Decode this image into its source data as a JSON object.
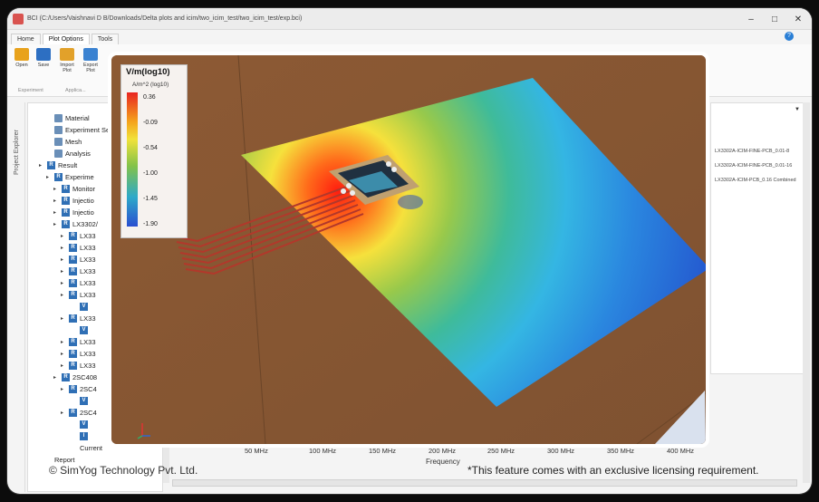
{
  "window": {
    "title": "BCI (C:/Users/Vaishnavi D B/Downloads/Delta plots and icim/two_icim_test/two_icim_test/exp.bci)",
    "minimize": "–",
    "maximize": "□",
    "close": "✕"
  },
  "menu": {
    "tabs": [
      "Home",
      "Plot Options",
      "Tools"
    ],
    "active": "Plot Options"
  },
  "ribbon": {
    "open": "Open",
    "save": "Save",
    "import_plot": "Import\nPlot",
    "export_plot": "Export\nPlot",
    "group_experiment": "Experiment",
    "group_apply": "Applica..."
  },
  "explorer": {
    "label": "Project Explorer",
    "tree": [
      {
        "text": "Material",
        "icon": "material"
      },
      {
        "text": "Experiment Se",
        "icon": "experiment"
      },
      {
        "text": "Mesh",
        "icon": "mesh"
      },
      {
        "text": "Analysis",
        "icon": "analysis"
      },
      {
        "text": "Result",
        "icon": "R"
      },
      {
        "text": "Experime",
        "icon": "R"
      },
      {
        "text": "Monitor",
        "icon": "R"
      },
      {
        "text": "Injectio",
        "icon": "R"
      },
      {
        "text": "Injectio",
        "icon": "R"
      },
      {
        "text": "LX3302/",
        "icon": "R"
      },
      {
        "text": "LX33",
        "icon": "R"
      },
      {
        "text": "LX33",
        "icon": "R"
      },
      {
        "text": "LX33",
        "icon": "R"
      },
      {
        "text": "LX33",
        "icon": "R"
      },
      {
        "text": "LX33",
        "icon": "R"
      },
      {
        "text": "LX33",
        "icon": "R"
      },
      {
        "text": "V",
        "icon": "V"
      },
      {
        "text": "LX33",
        "icon": "R"
      },
      {
        "text": "V",
        "icon": "V"
      },
      {
        "text": "LX33",
        "icon": "R"
      },
      {
        "text": "LX33",
        "icon": "R"
      },
      {
        "text": "LX33",
        "icon": "R"
      },
      {
        "text": "2SC408",
        "icon": "R"
      },
      {
        "text": "2SC4",
        "icon": "R"
      },
      {
        "text": "V",
        "icon": "V"
      },
      {
        "text": "2SC4",
        "icon": "R"
      },
      {
        "text": "V",
        "icon": "V"
      },
      {
        "text": "I",
        "icon": "I"
      },
      {
        "text": "Current",
        "icon": "none"
      },
      {
        "text": "Report",
        "icon": "none"
      }
    ]
  },
  "right_panel": {
    "items": [
      "LX3302A-ICIM-FINE-PCB_0.01-8",
      "LX3302A-ICIM-FINE-PCB_0.01-16",
      "LX3302A-ICIM-PCB_0.16 Combined"
    ]
  },
  "plot": {
    "colorbar_title": "V/m(log10)",
    "colorbar_subtitle": "A/m^2 (log10)",
    "ticks": [
      "0.36",
      "-0.09",
      "-0.54",
      "-1.00",
      "-1.45",
      "-1.90"
    ],
    "x_ticks": [
      "50 MHz",
      "100 MHz",
      "150 MHz",
      "200 MHz",
      "250 MHz",
      "300 MHz",
      "350 MHz",
      "400 MHz"
    ],
    "x_label": "Frequency"
  },
  "footer": {
    "company": "© SimYog Technology Pvt. Ltd.",
    "notice": "*This feature comes with an exclusive licensing requirement."
  }
}
